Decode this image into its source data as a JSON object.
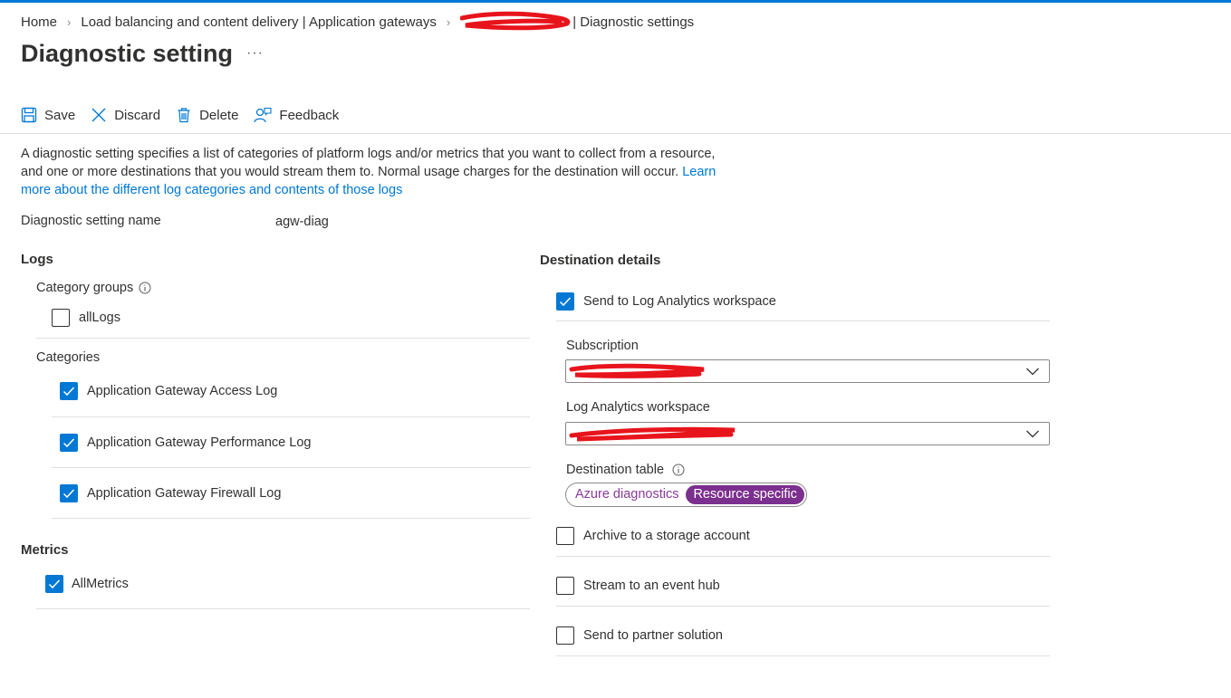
{
  "breadcrumb": {
    "home": "Home",
    "service": "Load balancing and content delivery | Application gateways",
    "resource_suffix": "| Diagnostic settings"
  },
  "page": {
    "title": "Diagnostic setting",
    "more": "···"
  },
  "toolbar": {
    "save": "Save",
    "discard": "Discard",
    "delete": "Delete",
    "feedback": "Feedback"
  },
  "description": {
    "text": "A diagnostic setting specifies a list of categories of platform logs and/or metrics that you want to collect from a resource, and one or more destinations that you would stream them to. Normal usage charges for the destination will occur. ",
    "link": "Learn more about the different log categories and contents of those logs"
  },
  "setting_name": {
    "label": "Diagnostic setting name",
    "value": "agw-diag"
  },
  "logs": {
    "heading": "Logs",
    "category_groups_label": "Category groups",
    "all_logs": {
      "label": "allLogs",
      "checked": false
    },
    "categories_label": "Categories",
    "categories": [
      {
        "label": "Application Gateway Access Log",
        "checked": true
      },
      {
        "label": "Application Gateway Performance Log",
        "checked": true
      },
      {
        "label": "Application Gateway Firewall Log",
        "checked": true
      }
    ]
  },
  "metrics": {
    "heading": "Metrics",
    "all_metrics": {
      "label": "AllMetrics",
      "checked": true
    }
  },
  "destination": {
    "heading": "Destination details",
    "log_analytics": {
      "label": "Send to Log Analytics workspace",
      "checked": true
    },
    "subscription_label": "Subscription",
    "workspace_label": "Log Analytics workspace",
    "table_label": "Destination table",
    "table_options": [
      "Azure diagnostics",
      "Resource specific"
    ],
    "table_selected": "Resource specific",
    "storage": {
      "label": "Archive to a storage account",
      "checked": false
    },
    "event_hub": {
      "label": "Stream to an event hub",
      "checked": false
    },
    "partner": {
      "label": "Send to partner solution",
      "checked": false
    }
  },
  "colors": {
    "accent": "#0078d4",
    "pill_selected": "#7b2f8e",
    "redaction": "#e8141c"
  }
}
